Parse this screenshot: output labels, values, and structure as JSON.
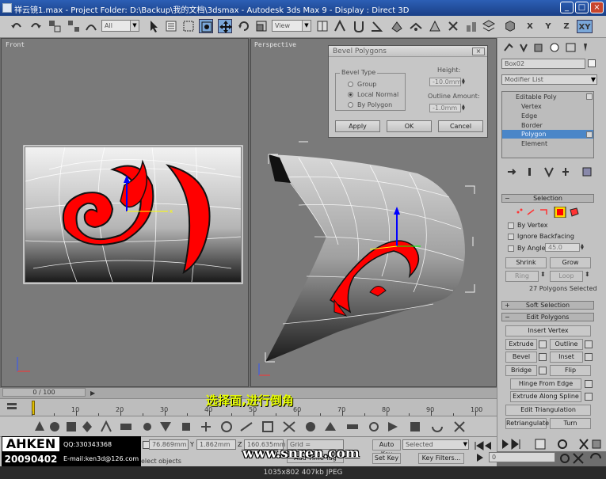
{
  "window": {
    "title": "祥云镜1.max    - Project Folder: D:\\Backup\\我的文档\\3dsmax    - Autodesk 3ds Max 9    - Display : Direct 3D"
  },
  "toolbar": {
    "selection_filter": "All",
    "ref_coord": "View",
    "axis_x": "X",
    "axis_y": "Y",
    "axis_z": "Z",
    "axis_xy": "XY"
  },
  "viewports": {
    "front_label": "Front",
    "perspective_label": "Perspective"
  },
  "bevel_dialog": {
    "title": "Bevel Polygons",
    "group_label": "Bevel Type",
    "options": [
      "Group",
      "Local Normal",
      "By Polygon"
    ],
    "selected_option": "Local Normal",
    "height_label": "Height:",
    "height_value": "-10.0mm",
    "outline_label": "Outline Amount:",
    "outline_value": "-1.0mm",
    "apply_label": "Apply",
    "ok_label": "OK",
    "cancel_label": "Cancel"
  },
  "command_panel": {
    "object_name": "Box02",
    "modifier_list": "Modifier List",
    "stack_items": [
      "Editable Poly",
      "Vertex",
      "Edge",
      "Border",
      "Polygon",
      "Element"
    ],
    "stack_selected": "Polygon",
    "selection_rollout": "Selection",
    "by_vertex": "By Vertex",
    "ignore_backfacing": "Ignore Backfacing",
    "by_angle": "By Angle:",
    "by_angle_value": "45.0",
    "shrink": "Shrink",
    "grow": "Grow",
    "ring": "Ring",
    "loop": "Loop",
    "selection_info": "27 Polygons Selected",
    "soft_selection_rollout": "Soft Selection",
    "edit_polygons_rollout": "Edit Polygons",
    "insert_vertex": "Insert Vertex",
    "extrude": "Extrude",
    "outline": "Outline",
    "bevel": "Bevel",
    "inset": "Inset",
    "bridge": "Bridge",
    "flip": "Flip",
    "hinge_from_edge": "Hinge From Edge",
    "extrude_along_spline": "Extrude Along Spline",
    "edit_triangulation": "Edit Triangulation",
    "retriangulate": "Retriangulate",
    "turn": "Turn"
  },
  "timeline": {
    "frame_readout": "0 / 100",
    "tick_labels": [
      "10",
      "20",
      "30",
      "40",
      "50",
      "60",
      "70",
      "80",
      "90",
      "100"
    ]
  },
  "status": {
    "x_label": "X",
    "x_value": "76.869mm",
    "y_label": "Y",
    "y_value": "1.862mm",
    "z_label": "Z",
    "z_value": "160.635mm",
    "grid": "Grid = 100.0mm",
    "prompt": "elect objects",
    "add_time_tag": "Add Time Tag",
    "auto_key": "Auto Key",
    "set_key": "Set Key",
    "selected": "Selected",
    "key_filters": "Key Filters...",
    "frame_field": "0"
  },
  "overlay": {
    "subtitle": "选择面,进行倒角",
    "logo_name": "AHKEN",
    "logo_date": "20090402",
    "qq": "QQ:330343368",
    "email": "E-mail:ken3d@126.com",
    "watermark": "www.snren.com",
    "footer": "1035x802  407kb  JPEG"
  },
  "colors": {
    "accent_red": "#ff0000",
    "selection_blue": "#4a86c8",
    "subtitle_yellow": "#e8ff00"
  }
}
